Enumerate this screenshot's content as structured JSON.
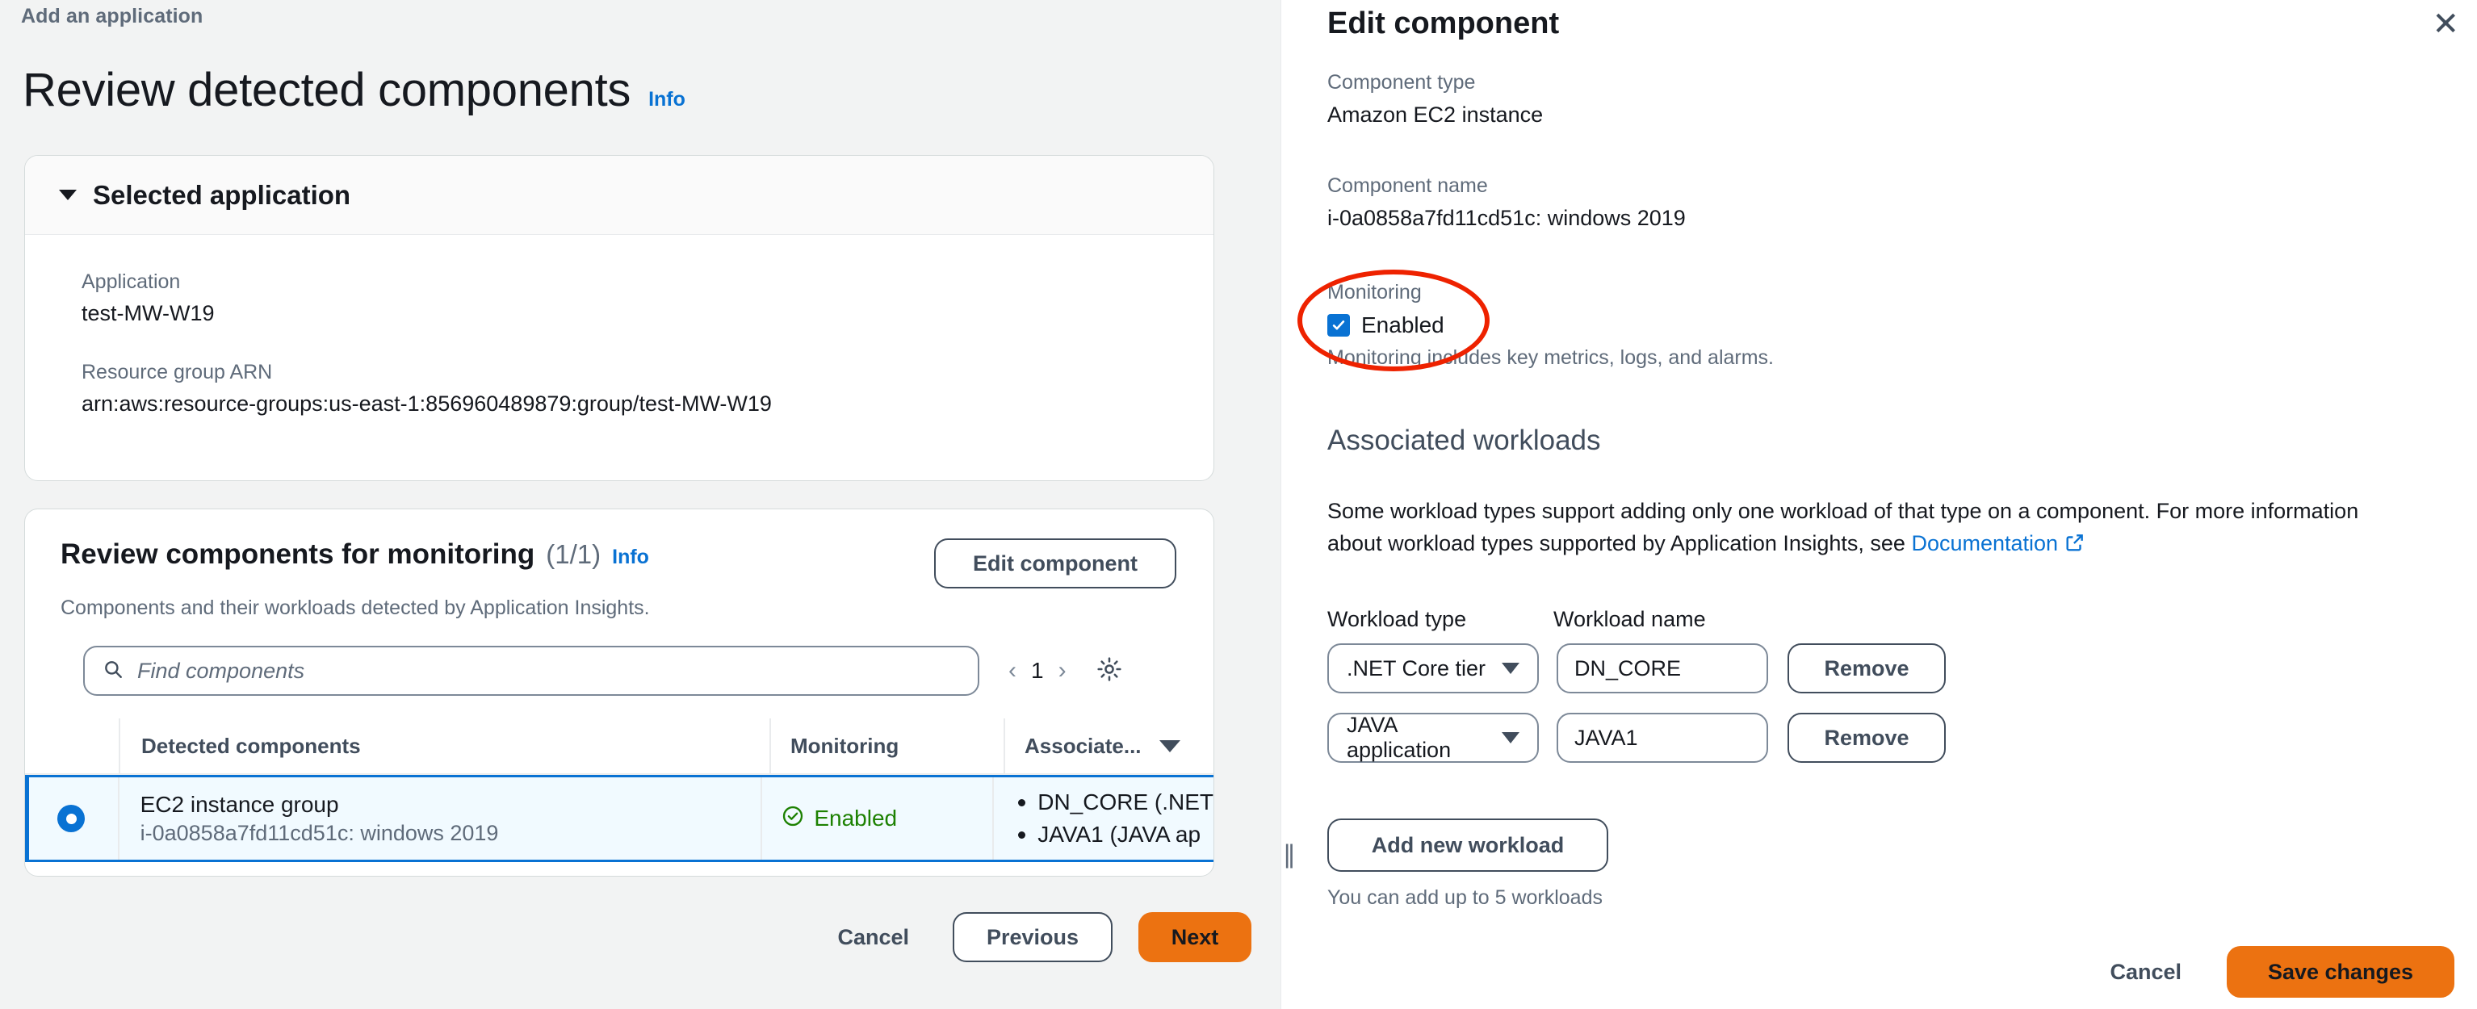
{
  "left": {
    "breadcrumb": "Add an application",
    "page_title": "Review detected components",
    "info_link": "Info",
    "selected_application": {
      "header": "Selected application",
      "application_label": "Application",
      "application_value": "test-MW-W19",
      "arn_label": "Resource group ARN",
      "arn_value": "arn:aws:resource-groups:us-east-1:856960489879:group/test-MW-W19"
    },
    "review": {
      "title": "Review components for monitoring",
      "count": "(1/1)",
      "info_link": "Info",
      "subtitle": "Components and their workloads detected by Application Insights.",
      "edit_component_button": "Edit component",
      "search_placeholder": "Find components",
      "search_value": "",
      "page_number": "1",
      "prev_arrow": "‹",
      "next_arrow": "›",
      "settings_icon": "gear-icon",
      "columns": [
        "Detected components",
        "Monitoring",
        "Associate..."
      ],
      "rows": [
        {
          "selected": true,
          "name": "EC2 instance group",
          "sub": "i-0a0858a7fd11cd51c: windows 2019",
          "monitoring": "Enabled",
          "workloads": [
            "DN_CORE (.NET",
            "JAVA1 (JAVA ap"
          ]
        }
      ]
    },
    "footer": {
      "cancel": "Cancel",
      "previous": "Previous",
      "next": "Next"
    }
  },
  "right": {
    "title": "Edit component",
    "close_icon": "close-icon",
    "component_type_label": "Component type",
    "component_type_value": "Amazon EC2 instance",
    "component_name_label": "Component name",
    "component_name_value": "i-0a0858a7fd11cd51c: windows 2019",
    "monitoring_label": "Monitoring",
    "monitoring_checkbox_label": "Enabled",
    "monitoring_checked": true,
    "monitoring_hint": "Monitoring includes key metrics, logs, and alarms.",
    "associated_workloads_heading": "Associated workloads",
    "associated_workloads_desc_1": "Some workload types support adding only one workload of that type on a component. For more information",
    "associated_workloads_desc_2": "about workload types supported by Application Insights, see ",
    "documentation_link": "Documentation",
    "workload_type_label": "Workload type",
    "workload_name_label": "Workload name",
    "workloads": [
      {
        "type": ".NET Core tier",
        "name": "DN_CORE",
        "remove_label": "Remove"
      },
      {
        "type": "JAVA application",
        "name": "JAVA1",
        "remove_label": "Remove"
      }
    ],
    "add_workload_button": "Add new workload",
    "workload_hint": "You can add up to 5 workloads",
    "footer": {
      "cancel": "Cancel",
      "save": "Save changes"
    }
  },
  "colors": {
    "accent_orange": "#ec7211",
    "link_blue": "#0972d3",
    "success_green": "#1d8102",
    "annotation_red": "#ee2200"
  }
}
